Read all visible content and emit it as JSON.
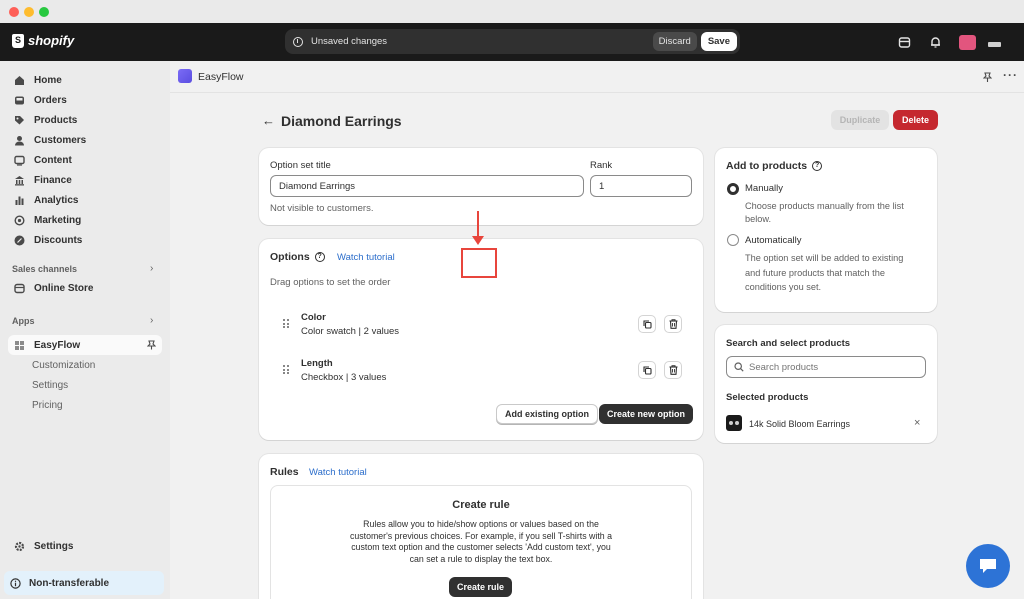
{
  "topbar": {
    "brand": "shopify",
    "unsaved_message": "Unsaved changes",
    "discard_label": "Discard",
    "save_label": "Save"
  },
  "sidebar": {
    "items": [
      {
        "label": "Home",
        "icon": "home-icon"
      },
      {
        "label": "Orders",
        "icon": "inbox-icon"
      },
      {
        "label": "Products",
        "icon": "tag-icon"
      },
      {
        "label": "Customers",
        "icon": "person-icon"
      },
      {
        "label": "Content",
        "icon": "content-icon"
      },
      {
        "label": "Finance",
        "icon": "bank-icon"
      },
      {
        "label": "Analytics",
        "icon": "chart-icon"
      },
      {
        "label": "Marketing",
        "icon": "target-icon"
      },
      {
        "label": "Discounts",
        "icon": "discount-icon"
      }
    ],
    "sales_channels_label": "Sales channels",
    "online_store_label": "Online Store",
    "apps_label": "Apps",
    "app_name": "EasyFlow",
    "app_subitems": [
      "Customization",
      "Settings",
      "Pricing"
    ],
    "settings_label": "Settings",
    "non_transferable_label": "Non-transferable"
  },
  "appbar": {
    "title": "EasyFlow"
  },
  "page": {
    "title": "Diamond Earrings",
    "duplicate_label": "Duplicate",
    "delete_label": "Delete"
  },
  "option_set": {
    "title_label": "Option set title",
    "title_value": "Diamond Earrings",
    "rank_label": "Rank",
    "rank_value": "1",
    "help_text": "Not visible to customers."
  },
  "options": {
    "heading": "Options",
    "watch_tutorial": "Watch tutorial",
    "hint": "Drag options to set the order",
    "items": [
      {
        "name": "Color",
        "detail": "Color swatch | 2 values"
      },
      {
        "name": "Length",
        "detail": "Checkbox | 3 values"
      }
    ],
    "add_existing_label": "Add existing option",
    "create_new_label": "Create new option"
  },
  "rules": {
    "heading": "Rules",
    "watch_tutorial": "Watch tutorial",
    "create_title": "Create rule",
    "description_lines": [
      "Rules allow you to hide/show options or values based on the",
      "customer's previous choices. For example, if you sell T-shirts with a",
      "custom text option and the customer selects 'Add custom text', you",
      "can set a rule to display the text box."
    ],
    "create_button": "Create rule"
  },
  "add_to_products": {
    "heading": "Add to products",
    "manual_label": "Manually",
    "manual_desc_lines": [
      "Choose products manually from the list",
      "below."
    ],
    "auto_label": "Automatically",
    "auto_desc_lines": [
      "The option set will be added to existing",
      "and future products that match the",
      "conditions you set."
    ],
    "selected": "manual"
  },
  "search_products": {
    "heading": "Search and select products",
    "placeholder": "Search products",
    "selected_heading": "Selected products",
    "selected_items": [
      {
        "name": "14k Solid Bloom Earrings"
      }
    ]
  },
  "colors": {
    "accent_link": "#2c6ecb",
    "delete": "#c5282f",
    "annotation": "#e8453c",
    "chat": "#2d73d6"
  }
}
